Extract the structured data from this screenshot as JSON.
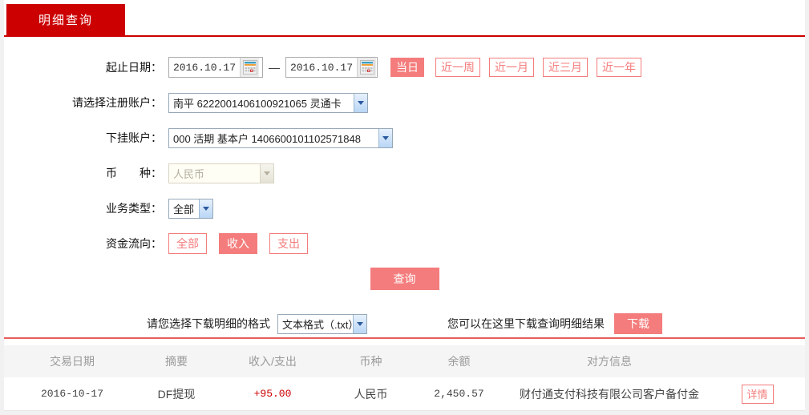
{
  "tab": {
    "label": "明细查询"
  },
  "form": {
    "date_range": {
      "label": "起止日期：",
      "start": "2016.10.17",
      "end": "2016.10.17",
      "separator": "—",
      "quick_buttons": [
        {
          "label": "当日",
          "active": true
        },
        {
          "label": "近一周",
          "active": false
        },
        {
          "label": "近一月",
          "active": false
        },
        {
          "label": "近三月",
          "active": false
        },
        {
          "label": "近一年",
          "active": false
        }
      ]
    },
    "register_account": {
      "label": "请选择注册账户：",
      "value": "南平 6222001406100921065 灵通卡"
    },
    "sub_account": {
      "label": "下挂账户：",
      "value": "000 活期 基本户 1406600101102571848"
    },
    "currency": {
      "label": "币　　种：",
      "value": "人民币",
      "disabled": true
    },
    "business_type": {
      "label": "业务类型：",
      "value": "全部"
    },
    "fund_flow": {
      "label": "资金流向：",
      "options": [
        {
          "label": "全部",
          "active": false
        },
        {
          "label": "收入",
          "active": true
        },
        {
          "label": "支出",
          "active": false
        }
      ]
    },
    "query_button": "查询",
    "download": {
      "format_label": "请您选择下载明细的格式",
      "format_value": "文本格式（.txt）",
      "hint": "您可以在这里下载查询明细结果",
      "button": "下载"
    }
  },
  "table": {
    "headers": [
      "交易日期",
      "摘要",
      "收入/支出",
      "币种",
      "余额",
      "对方信息"
    ],
    "rows": [
      {
        "date": "2016-10-17",
        "summary": "DF提现",
        "amount": "+95.00",
        "currency": "人民币",
        "balance": "2,450.57",
        "counterparty": "财付通支付科技有限公司客户备付金",
        "action": "详情"
      }
    ]
  },
  "colors": {
    "accent_red": "#cc0000",
    "salmon": "#f47c7c",
    "divider_red": "#e85d5d",
    "table_header_bg": "#f5f5f5",
    "amount_red": "#cc0000"
  },
  "icons": {
    "calendar": "calendar-icon",
    "chevron": "chevron-down-icon"
  }
}
